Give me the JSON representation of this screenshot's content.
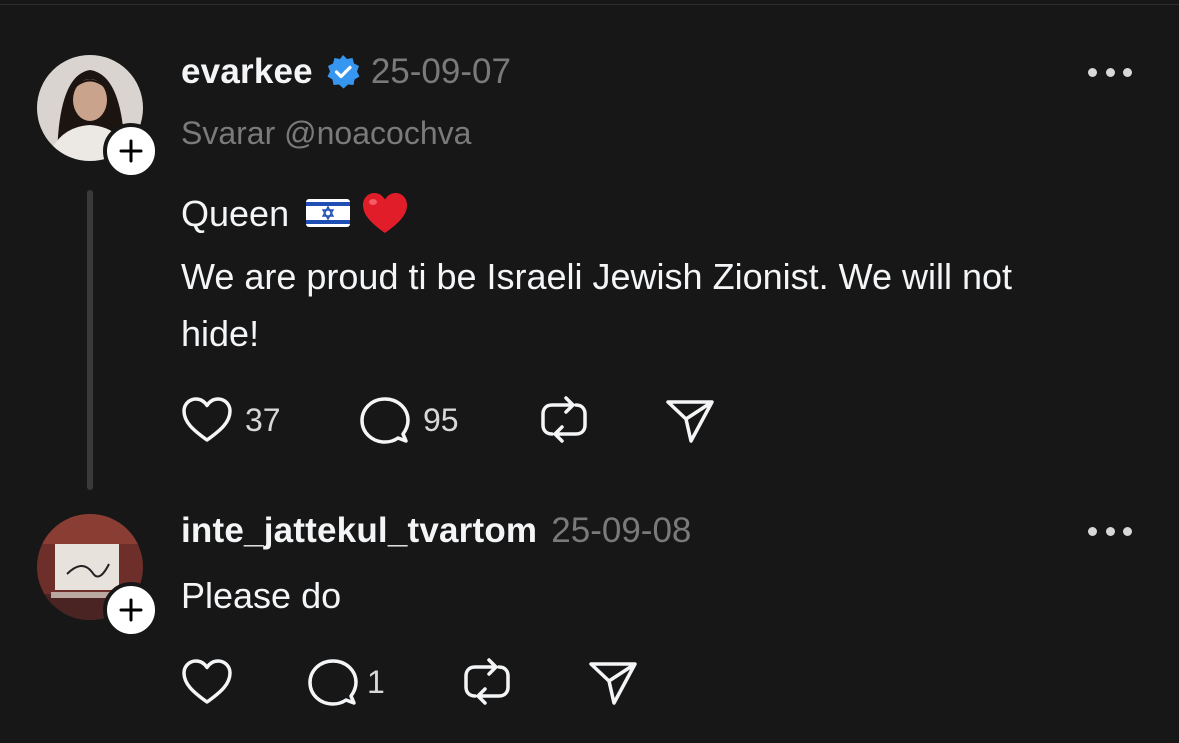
{
  "posts": [
    {
      "username": "evarkee",
      "verified": true,
      "date": "25-09-07",
      "reply_to": "Svarar @noacochva",
      "text_line1": "Queen",
      "text_line2": "We are proud ti be Israeli Jewish Zionist. We will not",
      "text_line3": "hide!",
      "likes": "37",
      "comments": "95"
    },
    {
      "username": "inte_jattekul_tvartom",
      "verified": false,
      "date": "25-09-08",
      "text_line1": "Please do",
      "likes": "",
      "comments": "1"
    }
  ],
  "colors": {
    "background": "#171717",
    "text": "#f3f5f7",
    "muted": "#7a7a7a",
    "verified": "#3797f0",
    "thread_line": "#3a3a3a"
  },
  "icons": [
    "heart-icon",
    "comment-icon",
    "repost-icon",
    "share-icon",
    "more-icon",
    "follow-plus-icon",
    "verified-badge-icon",
    "israel-flag-emoji",
    "red-heart-emoji"
  ]
}
